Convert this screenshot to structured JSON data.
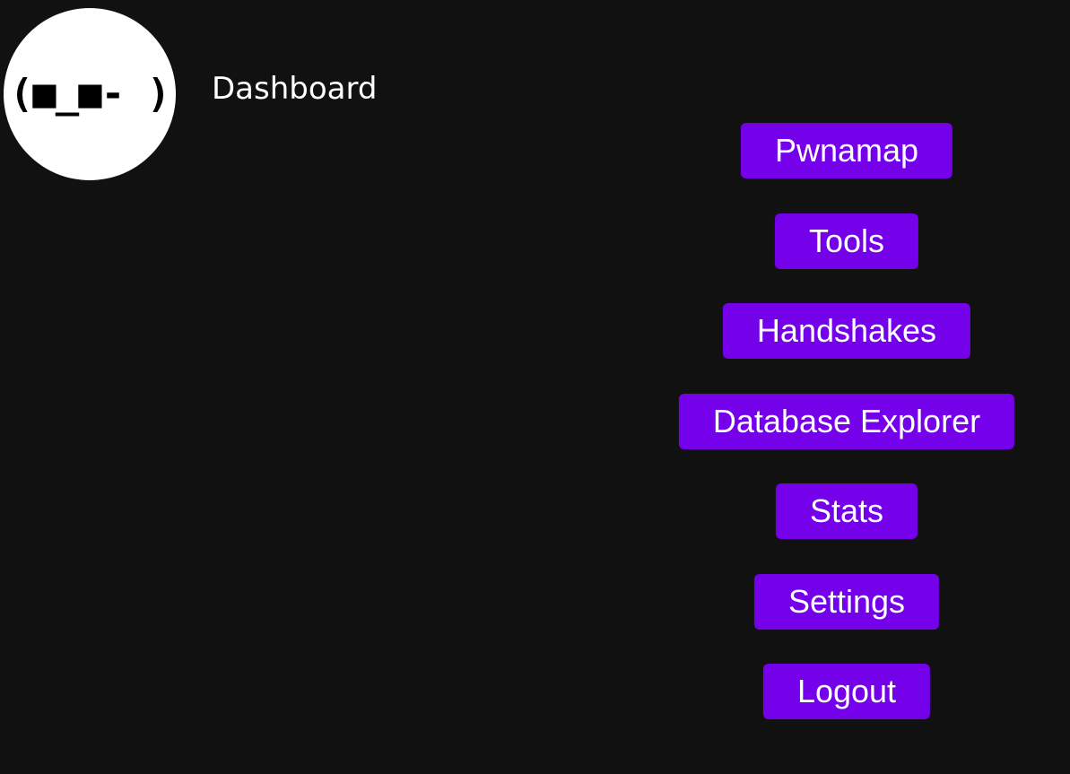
{
  "avatar": {
    "face": "(■_■- )"
  },
  "header": {
    "title": "Dashboard"
  },
  "nav": {
    "items": [
      {
        "label": "Pwnamap"
      },
      {
        "label": "Tools"
      },
      {
        "label": "Handshakes"
      },
      {
        "label": "Database Explorer"
      },
      {
        "label": "Stats"
      },
      {
        "label": "Settings"
      },
      {
        "label": "Logout"
      }
    ]
  },
  "colors": {
    "background": "#111111",
    "accent": "#7500ea",
    "text": "#ffffff",
    "avatar_bg": "#ffffff"
  }
}
